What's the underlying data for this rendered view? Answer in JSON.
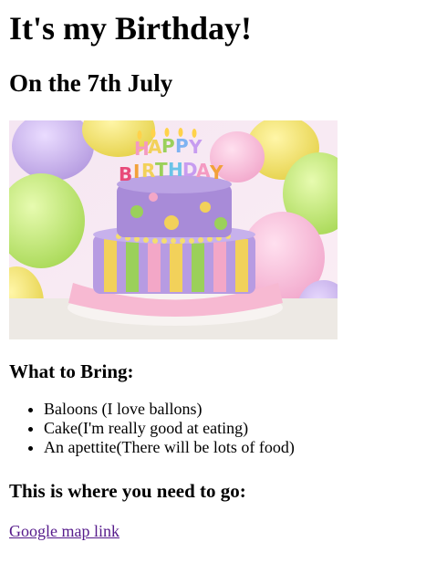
{
  "header": {
    "title": "It's my Birthday!",
    "subtitle": "On the 7th July"
  },
  "image": {
    "icon": "birthday-cake-image",
    "caption_letters": "HAPPY BIRTHDAY",
    "colors": {
      "cake_purple": "#a98fd6",
      "cake_pink": "#f3a7c7",
      "cake_yellow": "#f2d15a",
      "cake_green": "#9bd05a"
    }
  },
  "bring": {
    "heading": "What to Bring:",
    "items": [
      "Baloons (I love ballons)",
      "Cake(I'm really good at eating)",
      "An apettite(There will be lots of food)"
    ]
  },
  "directions": {
    "heading": "This is where you need to go:",
    "link_label": "Google map link",
    "link_color": "#551a8b"
  }
}
